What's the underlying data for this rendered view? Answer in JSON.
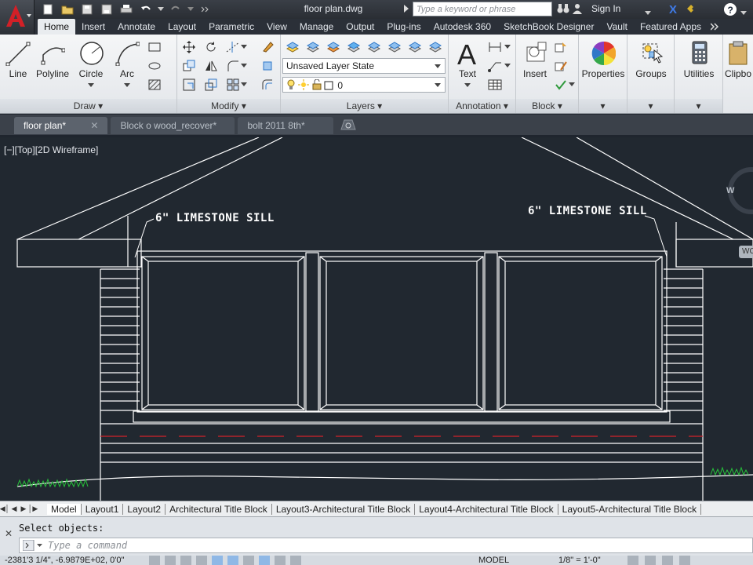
{
  "title_bar": {
    "document_title": "floor plan.dwg",
    "search_placeholder": "Type a keyword or phrase",
    "sign_in": "Sign In"
  },
  "ribbon": {
    "tabs": [
      "Home",
      "Insert",
      "Annotate",
      "Layout",
      "Parametric",
      "View",
      "Manage",
      "Output",
      "Plug-ins",
      "Autodesk 360",
      "SketchBook Designer",
      "Vault",
      "Featured Apps"
    ],
    "active_tab": "Home",
    "draw": {
      "title": "Draw",
      "line": "Line",
      "polyline": "Polyline",
      "circle": "Circle",
      "arc": "Arc"
    },
    "modify": {
      "title": "Modify"
    },
    "layers": {
      "title": "Layers",
      "layer_state": "Unsaved Layer State",
      "current_layer": "0"
    },
    "annotation": {
      "title": "Annotation",
      "text": "Text"
    },
    "block": {
      "title": "Block",
      "insert": "Insert"
    },
    "properties": "Properties",
    "groups": "Groups",
    "utilities": "Utilities",
    "clipboard": "Clipbo"
  },
  "doc_tabs": [
    {
      "label": "floor plan*",
      "active": true
    },
    {
      "label": "Block o wood_recover*",
      "active": false
    },
    {
      "label": "bolt 2011 8th*",
      "active": false
    }
  ],
  "viewport": {
    "label": "[−][Top][2D Wireframe]",
    "annotations": [
      "6\" LIMESTONE SILL",
      "6\" LIMESTONE SILL"
    ],
    "viewcube_letter": "W",
    "wcs_label": "WC"
  },
  "layout_tabs": [
    "Model",
    "Layout1",
    "Layout2",
    "Architectural Title Block",
    "Layout3-Architectural Title Block",
    "Layout4-Architectural Title Block",
    "Layout5-Architectural Title Block"
  ],
  "command": {
    "history": "Select objects:",
    "placeholder": "Type a command"
  },
  "status": {
    "coords": "-2381'3 1/4\", -6.9879E+02, 0'0\"",
    "model": "MODEL",
    "scale": "1/8\" = 1'-0\""
  },
  "colors": {
    "canvas": "#212830",
    "drawing_lines": "#ffffff",
    "hidden_line": "#d3222a",
    "grass": "#26c23a",
    "app_button": "#d32027"
  }
}
